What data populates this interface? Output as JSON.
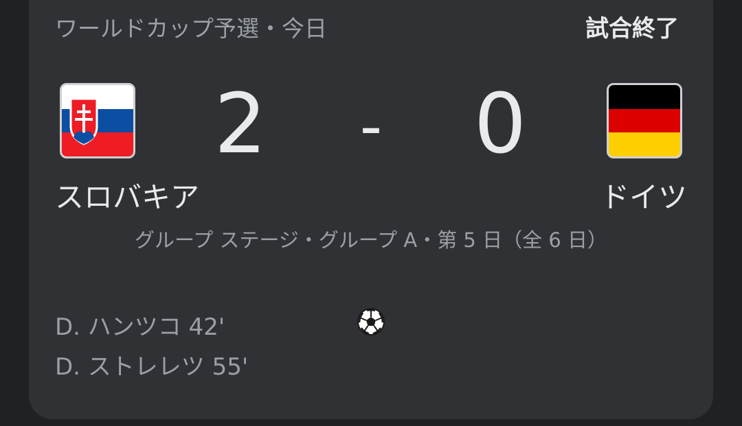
{
  "header": {
    "competition": "ワールドカップ予選・今日",
    "status": "試合終了"
  },
  "match": {
    "home": {
      "name": "スロバキア",
      "score": "2",
      "flag_icon": "slovakia-flag-icon"
    },
    "away": {
      "name": "ドイツ",
      "score": "0",
      "flag_icon": "germany-flag-icon"
    },
    "separator": "-",
    "stage": "グループ ステージ・グループ A・第 5 日（全 6 日）"
  },
  "scorers": {
    "icon": "soccer-ball-icon",
    "home": [
      {
        "text": "D. ハンツコ 42'"
      },
      {
        "text": "D. ストレレツ 55'"
      }
    ]
  },
  "colors": {
    "background": "#202124",
    "card": "#303134",
    "primary_text": "#e8eaed",
    "secondary_text": "#9aa0a6"
  }
}
